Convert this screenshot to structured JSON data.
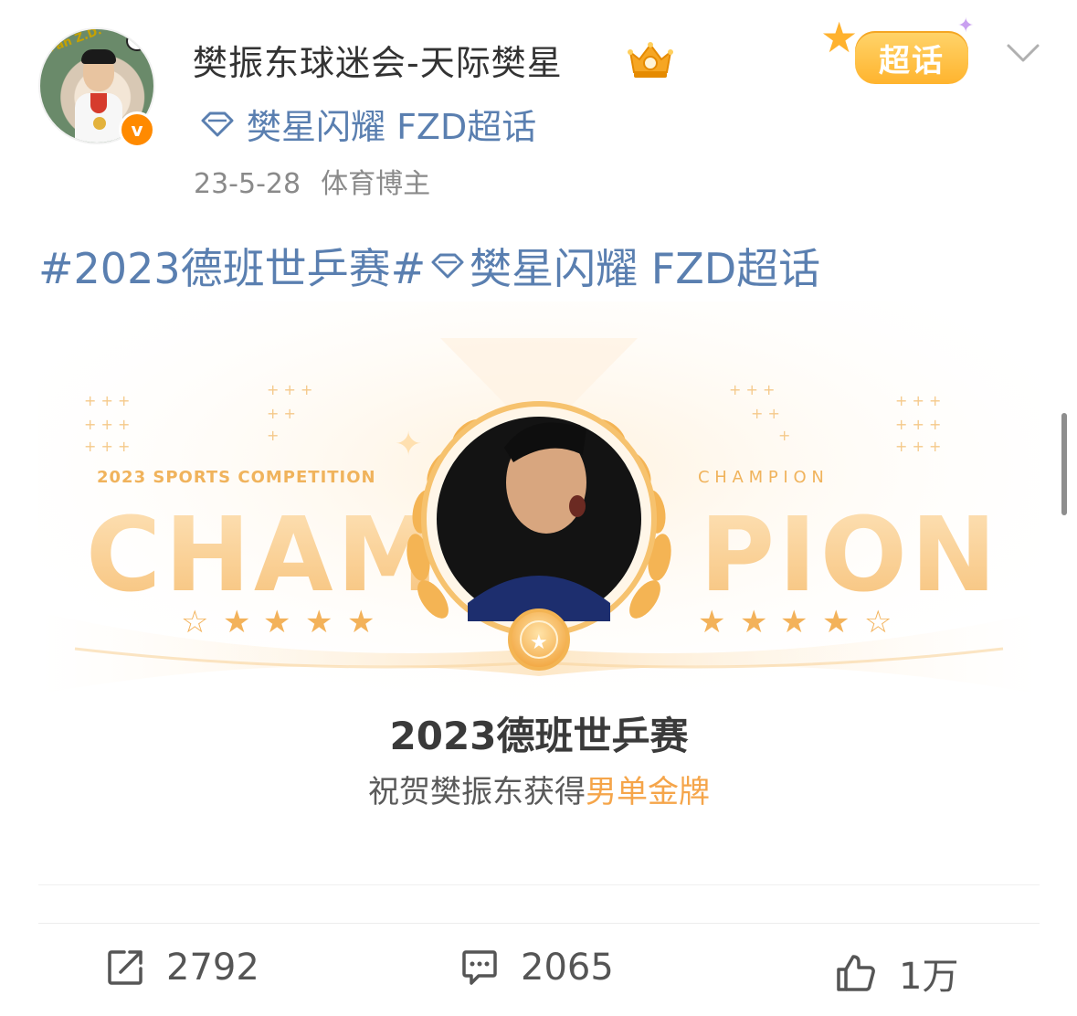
{
  "post": {
    "author": "樊振东球迷会-天际樊星",
    "topic_name": "樊星闪耀 FZD超话",
    "date": "23-5-28",
    "author_tag": "体育博主",
    "content_hashtag": "#2023德班世乒赛#",
    "content_topic": "樊星闪耀 FZD超话",
    "avatar_text": "Fan Z.D.",
    "verified_badge": "v",
    "chaohua_badge": "超话"
  },
  "card": {
    "left_caption": "2023 SPORTS COMPETITION",
    "left_word": "CHAM",
    "right_caption": "C H A M P I O N",
    "right_word": "PION",
    "title": "2023德班世乒赛",
    "subtitle_prefix": "祝贺樊振东获得",
    "subtitle_highlight": "男单金牌"
  },
  "actions": {
    "repost_count": "2792",
    "comment_count": "2065",
    "like_count": "1万"
  },
  "colors": {
    "link": "#5a7fb0",
    "accent_orange": "#ff8a00",
    "gold": "#f4b860",
    "highlight": "#f5a54a"
  },
  "icons": [
    "crown-icon",
    "diamond-topic-icon",
    "chevron-down-icon",
    "repost-icon",
    "comment-icon",
    "like-icon",
    "verified-icon"
  ]
}
